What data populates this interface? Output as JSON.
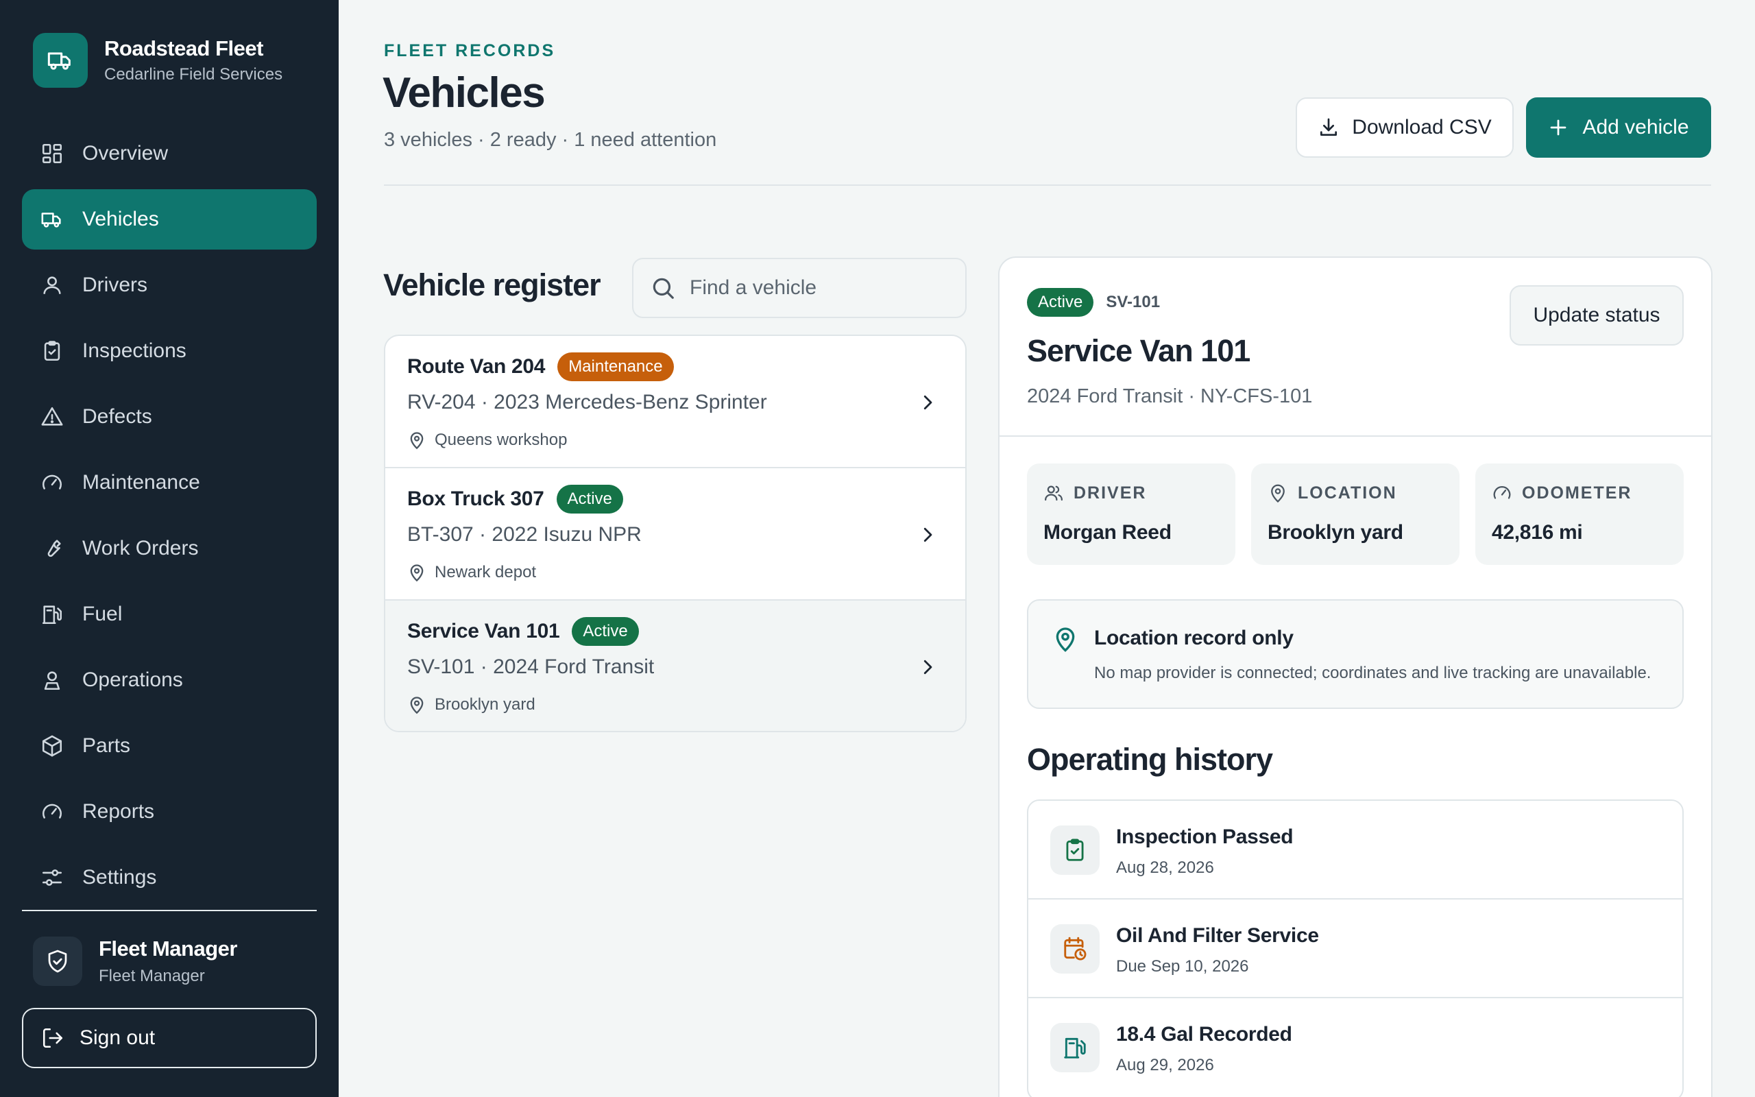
{
  "app": {
    "name": "Roadstead Fleet",
    "org": "Cedarline Field Services"
  },
  "nav": [
    {
      "id": "overview",
      "label": "Overview",
      "icon": "grid-icon"
    },
    {
      "id": "vehicles",
      "label": "Vehicles",
      "icon": "truck-icon",
      "active": true
    },
    {
      "id": "drivers",
      "label": "Drivers",
      "icon": "user-icon"
    },
    {
      "id": "inspections",
      "label": "Inspections",
      "icon": "clipboard-check-icon"
    },
    {
      "id": "defects",
      "label": "Defects",
      "icon": "warning-icon"
    },
    {
      "id": "maintenance",
      "label": "Maintenance",
      "icon": "gauge-icon"
    },
    {
      "id": "work-orders",
      "label": "Work Orders",
      "icon": "wrench-icon"
    },
    {
      "id": "fuel",
      "label": "Fuel",
      "icon": "fuel-icon"
    },
    {
      "id": "operations",
      "label": "Operations",
      "icon": "map-pin-user-icon"
    },
    {
      "id": "parts",
      "label": "Parts",
      "icon": "package-icon"
    },
    {
      "id": "reports",
      "label": "Reports",
      "icon": "gauge-icon"
    },
    {
      "id": "settings",
      "label": "Settings",
      "icon": "sliders-icon"
    }
  ],
  "user": {
    "name": "Fleet Manager",
    "role": "Fleet Manager"
  },
  "signout_label": "Sign out",
  "header": {
    "eyebrow": "FLEET RECORDS",
    "title": "Vehicles",
    "subtitle": "3 vehicles · 2 ready · 1 need attention",
    "download_label": "Download CSV",
    "add_label": "Add vehicle"
  },
  "register": {
    "title": "Vehicle register",
    "search_placeholder": "Find a vehicle",
    "vehicles": [
      {
        "name": "Route Van 204",
        "status": "Maintenance",
        "spec": "RV-204 · 2023 Mercedes-Benz Sprinter",
        "location": "Queens workshop"
      },
      {
        "name": "Box Truck 307",
        "status": "Active",
        "spec": "BT-307 · 2022 Isuzu NPR",
        "location": "Newark depot"
      },
      {
        "name": "Service Van 101",
        "status": "Active",
        "spec": "SV-101 · 2024 Ford Transit",
        "location": "Brooklyn yard",
        "selected": true
      }
    ]
  },
  "detail": {
    "status": "Active",
    "code": "SV-101",
    "title": "Service Van 101",
    "subtitle": "2024 Ford Transit · NY-CFS-101",
    "update_label": "Update status",
    "stats": {
      "driver": {
        "label": "DRIVER",
        "value": "Morgan Reed"
      },
      "location": {
        "label": "LOCATION",
        "value": "Brooklyn yard"
      },
      "odometer": {
        "label": "ODOMETER",
        "value": "42,816 mi"
      }
    },
    "notice": {
      "title": "Location record only",
      "body": "No map provider is connected; coordinates and live tracking are unavailable."
    },
    "history_title": "Operating history",
    "history": [
      {
        "name": "Inspection Passed",
        "date": "Aug 28, 2026",
        "icon": "clipboard-check-icon"
      },
      {
        "name": "Oil And Filter Service",
        "date": "Due Sep 10, 2026",
        "icon": "calendar-clock-icon"
      },
      {
        "name": "18.4 Gal Recorded",
        "date": "Aug 29, 2026",
        "icon": "fuel-icon"
      }
    ]
  },
  "colors": {
    "sidebar": "#17232f",
    "accent": "#0f766e",
    "maintenance": "#c65f0b",
    "active": "#157347",
    "background": "#f3f6f6"
  }
}
